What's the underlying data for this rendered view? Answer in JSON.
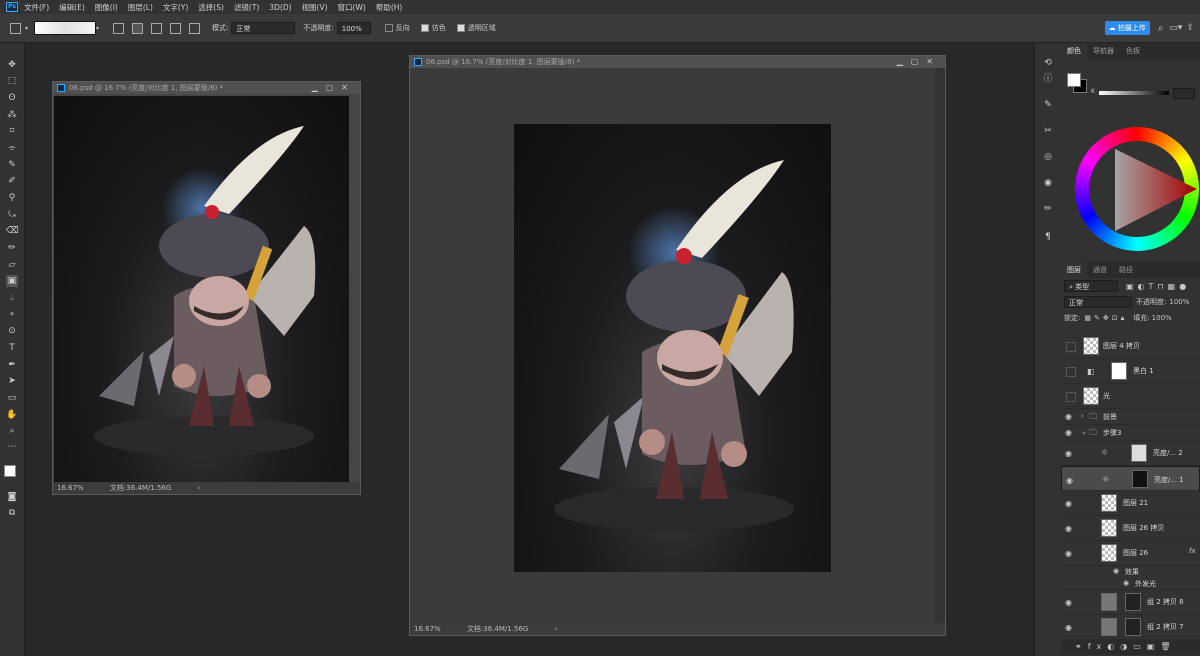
{
  "menu": {
    "app_icon": "Ps",
    "items": [
      "文件(F)",
      "编辑(E)",
      "图像(I)",
      "图层(L)",
      "文字(Y)",
      "选择(S)",
      "滤镜(T)",
      "3D(D)",
      "视图(V)",
      "窗口(W)",
      "帮助(H)"
    ]
  },
  "options": {
    "mode_label": "模式:",
    "mode_value": "正常",
    "opacity_label": "不透明度:",
    "opacity_value": "100%",
    "reverse_label": "反向",
    "dither_label": "仿色",
    "transparency_label": "透明区域",
    "upload_label": "拍摄上传",
    "cloud_icon": "cloud-icon"
  },
  "doc_small": {
    "title": "06.psd @ 16.7% (亮度/对比度 1, 图层蒙版/8) *",
    "zoom": "16.67%",
    "doc_info": "文档:36.4M/1.56G"
  },
  "doc_large": {
    "title": "06.psd @ 16.7% (亮度/对比度 1, 图层蒙版/8) *",
    "zoom": "16.67%",
    "doc_info": "文档:36.4M/1.56G"
  },
  "color_panel": {
    "tabs": [
      "颜色",
      "导航器",
      "色板"
    ],
    "active_tab": 0,
    "slider_label": "K"
  },
  "layers_panel": {
    "tabs": [
      "图层",
      "通道",
      "路径"
    ],
    "active_tab": 0,
    "filter_label": "类型",
    "blend_mode": "正常",
    "opacity_label": "不透明度:",
    "opacity_value": "100%",
    "lock_label": "锁定:",
    "fill_label": "填充:",
    "fill_value": "100%",
    "layers": [
      {
        "name": "图层 4 拷贝",
        "visible": false
      },
      {
        "name": "黑白 1",
        "visible": false
      },
      {
        "name": "光",
        "visible": false
      },
      {
        "name": "前景",
        "visible": true
      },
      {
        "name": "步骤3",
        "visible": true
      },
      {
        "name": "亮度/... 2",
        "visible": true
      },
      {
        "name": "亮度/... 1",
        "visible": true
      },
      {
        "name": "图层 21",
        "visible": true
      },
      {
        "name": "图层 26 拷贝",
        "visible": true
      },
      {
        "name": "图层 26",
        "visible": true
      },
      {
        "name": "效果",
        "visible": true
      },
      {
        "name": "外发光",
        "visible": true
      },
      {
        "name": "组 2 拷贝 8",
        "visible": true
      },
      {
        "name": "组 2 拷贝 7",
        "visible": true
      }
    ],
    "fx_label": "fx"
  },
  "colors": {
    "accent": "#31a8ff",
    "upload_btn": "#2d8ceb"
  }
}
